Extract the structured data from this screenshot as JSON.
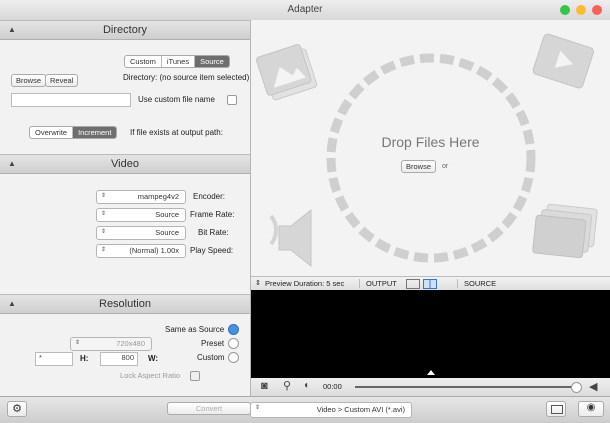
{
  "window": {
    "title": "Adapter"
  },
  "directory": {
    "header": "Directory",
    "tabs": [
      "Source",
      "iTunes",
      "Custom"
    ],
    "directory_label": "Directory:",
    "directory_value": "(no source item selected)",
    "reveal": "Reveal",
    "browse": "Browse",
    "custom_name_label": "Use custom file name",
    "exists_label": "If file exists at output path:",
    "exists_options": [
      "Increment",
      "Overwrite"
    ]
  },
  "video": {
    "header": "Video",
    "rows": [
      {
        "label": "Encoder:",
        "value": "mampeg4v2"
      },
      {
        "label": "Frame Rate:",
        "value": "Source"
      },
      {
        "label": "Bit Rate:",
        "value": "Source"
      },
      {
        "label": "Play Speed:",
        "value": "(Normal) 1.00x"
      }
    ]
  },
  "resolution": {
    "header": "Resolution",
    "same_as_source": "Same as Source",
    "preset": "Preset",
    "preset_value": "720x480",
    "custom": "Custom",
    "w_label": "W:",
    "w_value": "800",
    "h_label": "H:",
    "h_value": "*",
    "lock_label": "Lock Aspect Ratio"
  },
  "drop": {
    "title": "Drop Files Here",
    "or": "or",
    "browse": "Browse"
  },
  "preview_bar": {
    "duration_label": "Preview Duration:",
    "duration_value": "5 sec",
    "output": "OUTPUT",
    "source": "SOURCE"
  },
  "player": {
    "time": "00:00"
  },
  "bottom": {
    "convert": "Convert",
    "format": "Video > Custom AVI (*.avi)"
  },
  "colors": {
    "close": "#fc5f57",
    "minimize": "#fdbc2e",
    "zoom": "#33c748",
    "selected": "#6e6e6e"
  }
}
